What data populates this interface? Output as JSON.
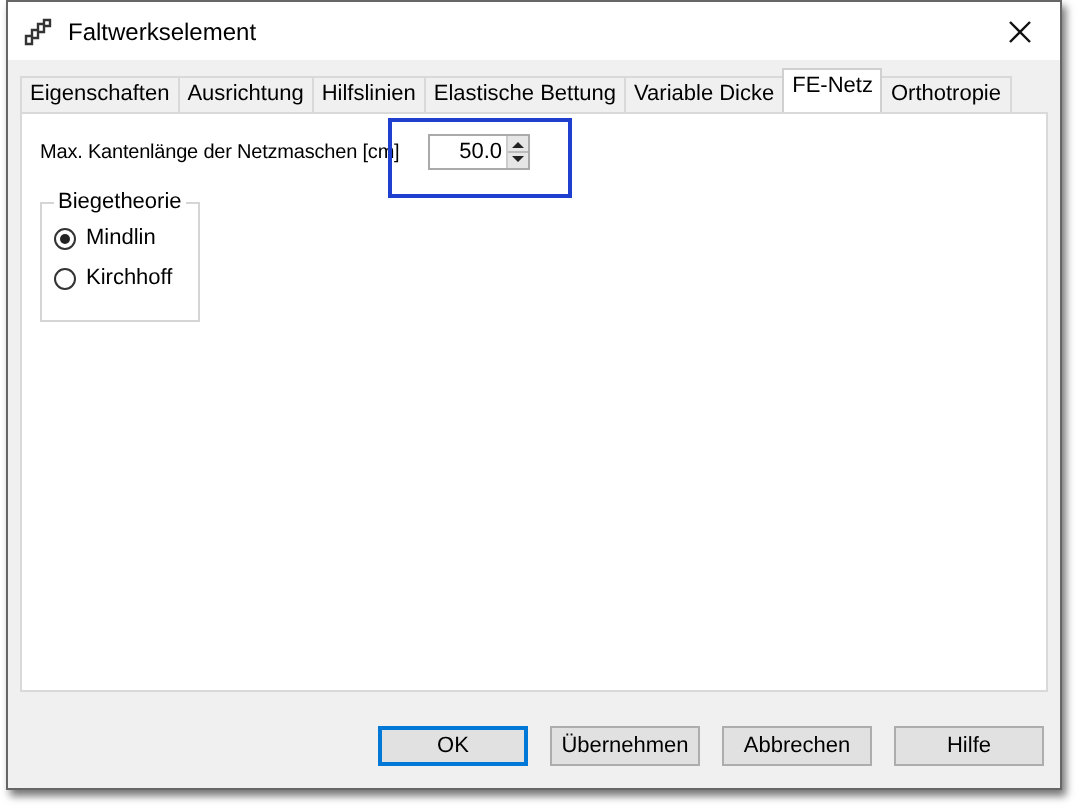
{
  "window": {
    "title": "Faltwerkselement"
  },
  "tabs": [
    {
      "label": "Eigenschaften",
      "selected": false
    },
    {
      "label": "Ausrichtung",
      "selected": false
    },
    {
      "label": "Hilfslinien",
      "selected": false
    },
    {
      "label": "Elastische Bettung",
      "selected": false
    },
    {
      "label": "Variable Dicke",
      "selected": false
    },
    {
      "label": "FE-Netz",
      "selected": true
    },
    {
      "label": "Orthotropie",
      "selected": false
    }
  ],
  "mesh_size": {
    "label": "Max. Kantenlänge der Netzmaschen [cm]",
    "value": "50.0",
    "highlighted": true
  },
  "bending_theory": {
    "title": "Biegetheorie",
    "options": [
      {
        "label": "Mindlin",
        "selected": true
      },
      {
        "label": "Kirchhoff",
        "selected": false
      }
    ]
  },
  "buttons": [
    {
      "label": "OK",
      "default": true
    },
    {
      "label": "Übernehmen",
      "default": false
    },
    {
      "label": "Abbrechen",
      "default": false
    },
    {
      "label": "Hilfe",
      "default": false
    }
  ]
}
